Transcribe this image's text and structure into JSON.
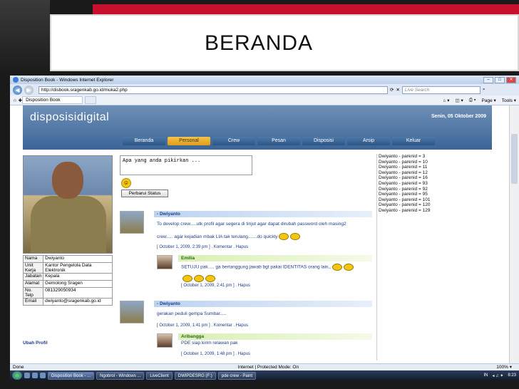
{
  "slide": {
    "title": "BERANDA"
  },
  "browser": {
    "window_title": "Disposition Book - Windows Internet Explorer",
    "url": "http://disbook.sragenkab.go.id/muka2.php",
    "search_placeholder": "Live Search",
    "tab_label": "Disposition Book",
    "cmd_page": "Page ▾",
    "cmd_tools": "Tools ▾",
    "status_left": "Done",
    "status_zone": "Internet | Protected Mode: On",
    "status_zoom": "100% ▾"
  },
  "site": {
    "logo": "disposisidigital",
    "date": "Senin, 05 Oktober 2009",
    "nav": [
      {
        "label": "Beranda"
      },
      {
        "label": "Personal"
      },
      {
        "label": "Crew"
      },
      {
        "label": "Pesan"
      },
      {
        "label": "Disposisi"
      },
      {
        "label": "Arsip"
      },
      {
        "label": "Keluar"
      }
    ]
  },
  "profile": {
    "rows": [
      {
        "k": "Nama",
        "v": "Dwiyanto"
      },
      {
        "k": "Unit Kerja",
        "v": "Kantor Pengelola Data Elektronik"
      },
      {
        "k": "Jabatan",
        "v": "Kepala"
      },
      {
        "k": "Alamat",
        "v": "Gemolong Sragen"
      },
      {
        "k": "No. Telp",
        "v": "081329050934"
      },
      {
        "k": "Email",
        "v": "dwiyanto@sragenkab.go.id"
      }
    ],
    "edit_link": "Ubah Profil"
  },
  "status": {
    "placeholder": "Apa yang anda pikirkan ...",
    "button": "Perbarui Status"
  },
  "feed": {
    "post1": {
      "author": "- Dwiyanto",
      "line1": "To develop crew.....utk profil agar segera di tinjut agar dapat dirubah password oleh masing2",
      "line2": "crew..... agar kejadian mbak LIA tak terulang.......do quickly",
      "meta": "[ October 1, 2009, 2:39 pm ]  . Komentar  .  Hapus",
      "reply": {
        "author": "Emilia",
        "text": "SETUJU pak..... ga bertanggung jawab bgt pakai IDENTITAS orang lain,,",
        "meta": "[ October 1, 2009, 2:41 pm ]  .  Hapus"
      }
    },
    "post2": {
      "author": "- Dwiyanto",
      "line1": "gerakan peduli gempa Sumbar.....",
      "meta": "[ October 1, 2009, 1:41 pm ]  . Komentar  .  Hapus",
      "reply": {
        "author": "Aribangga",
        "text": "PDE siap kirim relawan pak",
        "meta": "[ October 1, 2009, 1:48 pm ]  .  Hapus"
      }
    }
  },
  "parent_list": [
    "Dwiyanto - parenid = 3",
    "Dwiyanto - parenid = 10",
    "Dwiyanto - parenid = 11",
    "Dwiyanto - parenid = 12",
    "Dwiyanto - parenid = 16",
    "Dwiyanto - parenid = 93",
    "Dwiyanto - parenid = 92",
    "Dwiyanto - parenid = 95",
    "Dwiyanto - parenid = 101",
    "Dwiyanto - parenid = 120",
    "Dwiyanto - parenid = 129"
  ],
  "taskbar": {
    "tasks": [
      {
        "label": "Disposition Book - ..."
      },
      {
        "label": "Ngobrol - Windows ..."
      },
      {
        "label": "LiveClient"
      },
      {
        "label": "DWIPDESRG (F:)"
      },
      {
        "label": "pde crew - Paint"
      }
    ],
    "clock": "8:23",
    "lang": "IN"
  },
  "colors": {
    "slide_red": "#c8102e",
    "site_header": "#3b6597",
    "nav_active": "#e09a17",
    "link": "#1f3c88"
  }
}
